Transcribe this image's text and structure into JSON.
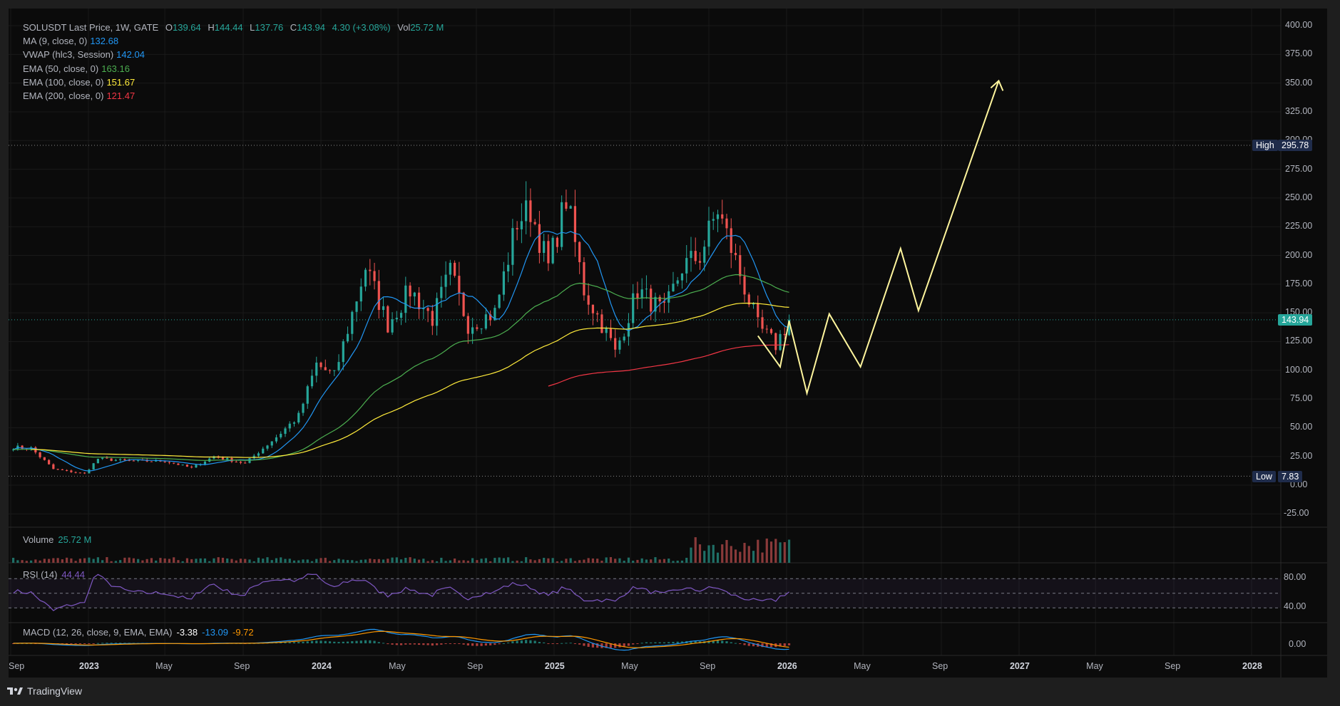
{
  "header": {
    "symbol_line": "SOLUSDT Last Price, 1W, GATE",
    "ohlc": [
      {
        "k": "O",
        "v": "139.64"
      },
      {
        "k": "H",
        "v": "144.44"
      },
      {
        "k": "L",
        "v": "137.76"
      },
      {
        "k": "C",
        "v": "143.94"
      }
    ],
    "change": "4.30 (+3.08%)",
    "vol_label": "Vol",
    "vol_value": "25.72 M"
  },
  "indicators": [
    {
      "label": "MA (9, close, 0)",
      "value": "132.68",
      "color": "#2196f3"
    },
    {
      "label": "VWAP (hlc3, Session)",
      "value": "142.04",
      "color": "#2196f3"
    },
    {
      "label": "EMA (50, close, 0)",
      "value": "163.16",
      "color": "#4caf50"
    },
    {
      "label": "EMA (100, close, 0)",
      "value": "151.67",
      "color": "#ffeb3b"
    },
    {
      "label": "EMA (200, close, 0)",
      "value": "121.47",
      "color": "#f23645"
    }
  ],
  "panes": {
    "volume": {
      "label": "Volume",
      "value": "25.72 M",
      "color": "#26a69a"
    },
    "rsi": {
      "label": "RSI (14)",
      "value": "44.44",
      "color": "#7e57c2"
    },
    "macd": {
      "label": "MACD (12, 26, close, 9, EMA, EMA)",
      "v1": "-3.38",
      "v2": "-13.09",
      "v3": "-9.72",
      "c1": "#ffffff",
      "c2": "#2196f3",
      "c3": "#ff9800"
    }
  },
  "price_axis": {
    "ticks": [
      "400.00",
      "375.00",
      "350.00",
      "325.00",
      "300.00",
      "275.00",
      "250.00",
      "225.00",
      "200.00",
      "175.00",
      "150.00",
      "125.00",
      "100.00",
      "75.00",
      "50.00",
      "25.00",
      "0.00",
      "-25.00"
    ],
    "tick_values": [
      400,
      375,
      350,
      325,
      300,
      275,
      250,
      225,
      200,
      175,
      150,
      125,
      100,
      75,
      50,
      25,
      0,
      -25
    ],
    "last_price": "143.94",
    "high_label": "High",
    "high_value": "295.78",
    "low_label": "Low",
    "low_value": "7.83"
  },
  "rsi_axis": {
    "ticks": [
      "80.00",
      "40.00"
    ]
  },
  "macd_axis": {
    "ticks": [
      "0.00"
    ]
  },
  "time_axis": {
    "labels": [
      "Sep",
      "2023",
      "May",
      "Sep",
      "2024",
      "May",
      "Sep",
      "2025",
      "May",
      "Sep",
      "2026",
      "May",
      "Sep",
      "2027",
      "May",
      "Sep",
      "2028"
    ],
    "bold": [
      false,
      true,
      false,
      false,
      true,
      false,
      false,
      true,
      false,
      false,
      true,
      false,
      false,
      true,
      false,
      false,
      true
    ]
  },
  "footer": {
    "brand": "TradingView"
  },
  "colors": {
    "up": "#26a69a",
    "down": "#ef5350",
    "projection": "#fff59d",
    "accent_last": "#26a69a"
  },
  "chart_data": {
    "type": "candlestick",
    "timeframe": "1W",
    "ylim": [
      -25,
      400
    ],
    "x_ticks": [
      "Sep 2022",
      "2023",
      "May 2023",
      "Sep 2023",
      "2024",
      "May 2024",
      "Sep 2024",
      "2025",
      "May 2025",
      "Sep 2025",
      "2026",
      "May 2026",
      "Sep 2026",
      "2027",
      "May 2027",
      "Sep 2027",
      "2028"
    ],
    "close_series": [
      {
        "date": "2022-09-05",
        "close": 33
      },
      {
        "date": "2022-10-03",
        "close": 32
      },
      {
        "date": "2022-11-07",
        "close": 14
      },
      {
        "date": "2022-12-26",
        "close": 10
      },
      {
        "date": "2023-01-16",
        "close": 23
      },
      {
        "date": "2023-03-06",
        "close": 21
      },
      {
        "date": "2023-05-01",
        "close": 21
      },
      {
        "date": "2023-06-12",
        "close": 15
      },
      {
        "date": "2023-07-17",
        "close": 25
      },
      {
        "date": "2023-09-04",
        "close": 19
      },
      {
        "date": "2023-10-23",
        "close": 42
      },
      {
        "date": "2023-11-27",
        "close": 60
      },
      {
        "date": "2023-12-25",
        "close": 105
      },
      {
        "date": "2024-01-22",
        "close": 95
      },
      {
        "date": "2024-03-11",
        "close": 190
      },
      {
        "date": "2024-04-15",
        "close": 140
      },
      {
        "date": "2024-05-20",
        "close": 170
      },
      {
        "date": "2024-06-24",
        "close": 145
      },
      {
        "date": "2024-07-22",
        "close": 185
      },
      {
        "date": "2024-08-19",
        "close": 140
      },
      {
        "date": "2024-09-30",
        "close": 150
      },
      {
        "date": "2024-11-04",
        "close": 230
      },
      {
        "date": "2024-11-25",
        "close": 240
      },
      {
        "date": "2024-12-23",
        "close": 190
      },
      {
        "date": "2025-01-20",
        "close": 250
      },
      {
        "date": "2025-02-17",
        "close": 170
      },
      {
        "date": "2025-03-31",
        "close": 125
      },
      {
        "date": "2025-04-07",
        "close": 115
      },
      {
        "date": "2025-05-12",
        "close": 170
      },
      {
        "date": "2025-06-23",
        "close": 150
      },
      {
        "date": "2025-07-21",
        "close": 190
      },
      {
        "date": "2025-08-18",
        "close": 200
      },
      {
        "date": "2025-09-15",
        "close": 240
      },
      {
        "date": "2025-10-13",
        "close": 195
      },
      {
        "date": "2025-11-17",
        "close": 138
      },
      {
        "date": "2025-12-15",
        "close": 122
      },
      {
        "date": "2026-01-05",
        "close": 143.94
      }
    ],
    "projection_path": [
      {
        "date": "2025-11-17",
        "price": 130
      },
      {
        "date": "2025-12-22",
        "price": 103
      },
      {
        "date": "2026-01-05",
        "price": 143
      },
      {
        "date": "2026-02-02",
        "price": 80
      },
      {
        "date": "2026-03-09",
        "price": 149
      },
      {
        "date": "2026-04-27",
        "price": 103
      },
      {
        "date": "2026-06-29",
        "price": 206
      },
      {
        "date": "2026-07-27",
        "price": 152
      },
      {
        "date": "2026-11-30",
        "price": 352
      }
    ],
    "high": 295.78,
    "low": 7.83,
    "last_close": 143.94,
    "rsi_levels": [
      70,
      50,
      30
    ]
  }
}
